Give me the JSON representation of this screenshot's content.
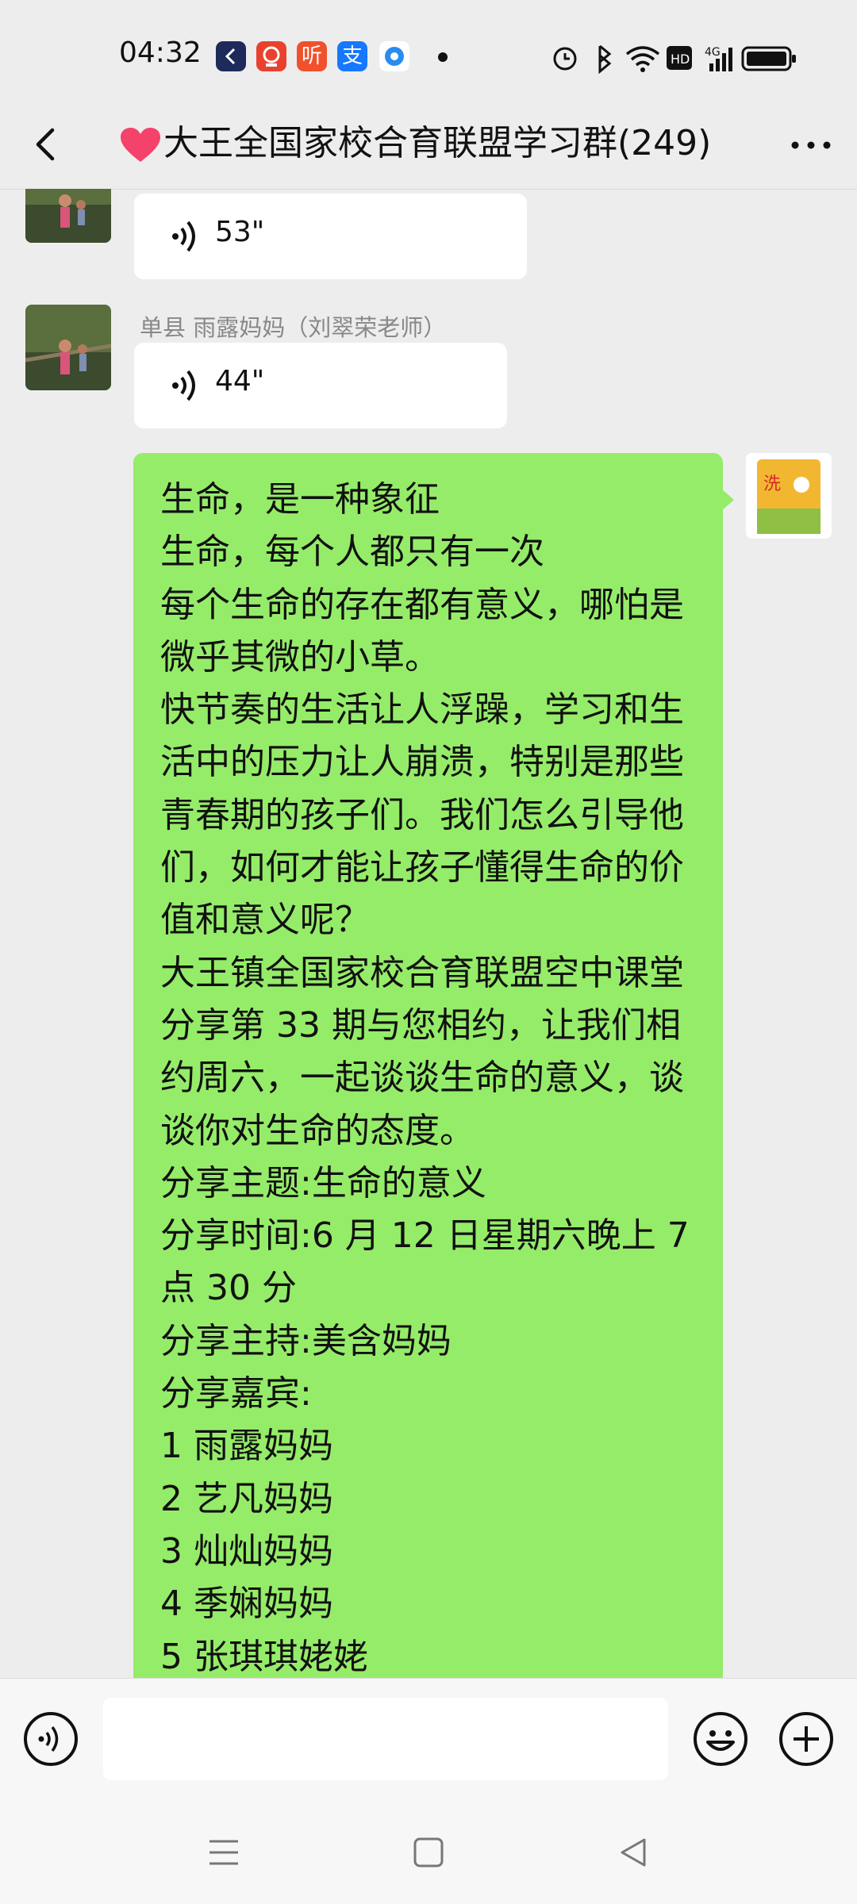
{
  "status": {
    "time": "04:32",
    "app_badges": [
      "听",
      "支"
    ]
  },
  "header": {
    "title": "大王全国家校合育联盟学习群(249)"
  },
  "messages": [
    {
      "type": "voice",
      "duration": "53\""
    },
    {
      "type": "voice",
      "sender": "单县 雨露妈妈（刘翠荣老师）",
      "duration": "44\""
    },
    {
      "type": "text",
      "lines": [
        "生命，是一种象征",
        "生命，每个人都只有一次",
        "每个生命的存在都有意义，哪怕是",
        "微乎其微的小草。",
        "快节奏的生活让人浮躁，学习和生",
        "活中的压力让人崩溃，特别是那些",
        "青春期的孩子们。我们怎么引导他",
        "们，如何才能让孩子懂得生命的价",
        "值和意义呢？",
        "大王镇全国家校合育联盟空中课堂",
        "分享第 33 期与您相约，让我们相",
        "约周六，一起谈谈生命的意义，谈",
        "谈你对生命的态度。",
        "分享主题:生命的意义",
        "分享时间:6 月 12 日星期六晚上 7",
        "点 30 分",
        "分享主持:美含妈妈",
        "分享嘉宾:",
        "1 雨露妈妈",
        "2 艺凡妈妈",
        "3 灿灿妈妈",
        "4 季娴妈妈",
        "5 张琪琪姥姥"
      ]
    }
  ],
  "colors": {
    "bubble_self": "#95ec69",
    "bubble_other": "#ffffff",
    "background": "#ededed"
  },
  "icons": [
    "back-icon",
    "more-icon",
    "voice-wave-icon",
    "voice-input-icon",
    "emoji-icon",
    "plus-icon",
    "menu-icon",
    "home-icon",
    "back-triangle-icon"
  ]
}
